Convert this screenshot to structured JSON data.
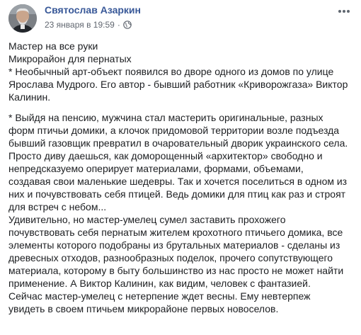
{
  "post": {
    "author": "Святослав Азаркин",
    "date": "23 января в 19:59",
    "separator": "·",
    "privacy_icon": "globe-icon",
    "more_icon": "more-options-icon",
    "lines_block1": [
      "Мастер на все руки",
      "Микрорайон для пернатых",
      "* Необычный арт-объект появился во дворе одного из домов по улице",
      "Ярослава Мудрого. Его автор - бывший работник «Криворожгаза» Виктор",
      "Калинин."
    ],
    "lines_block2": [
      "* Выйдя на пенсию, мужчина стал мастерить оригинальные, разных",
      "форм птичьи домики, а клочок придомовой территории возле подъезда",
      "бывший газовщик превратил в очаровательный дворик украинского села.",
      "Просто диву даешься, как доморощенный «архитектор» свободно и",
      "непредсказуемо оперирует материалами, формами, объемами,",
      "создавая свои маленькие шедевры. Так и хочется поселиться в одном из",
      "них и почувствовать себя птицей. Ведь домики для птиц как раз и строят",
      "для встреч с небом...",
      "Удивительно, но мастер-умелец сумел заставить прохожего",
      "почувствовать себя пернатым жителем крохотного птичьего домика, все",
      "элементы которого подобраны из брутальных материалов - сделаны из",
      "древесных отходов, разнообразных поделок, прочего сопутствующего",
      "материала, которому в быту большинство из нас просто не может найти",
      "применение. А Виктор Калинин, как видим, человек с фантазией.",
      "Сейчас мастер-умелец с нетерпение ждет весны. Ему невтерпеж",
      "увидеть в своем птичьем микрорайоне первых новоселов."
    ]
  },
  "colors": {
    "author_link": "#385898",
    "meta_text": "#616770",
    "body_text": "#1c1e21",
    "background": "#ffffff"
  }
}
